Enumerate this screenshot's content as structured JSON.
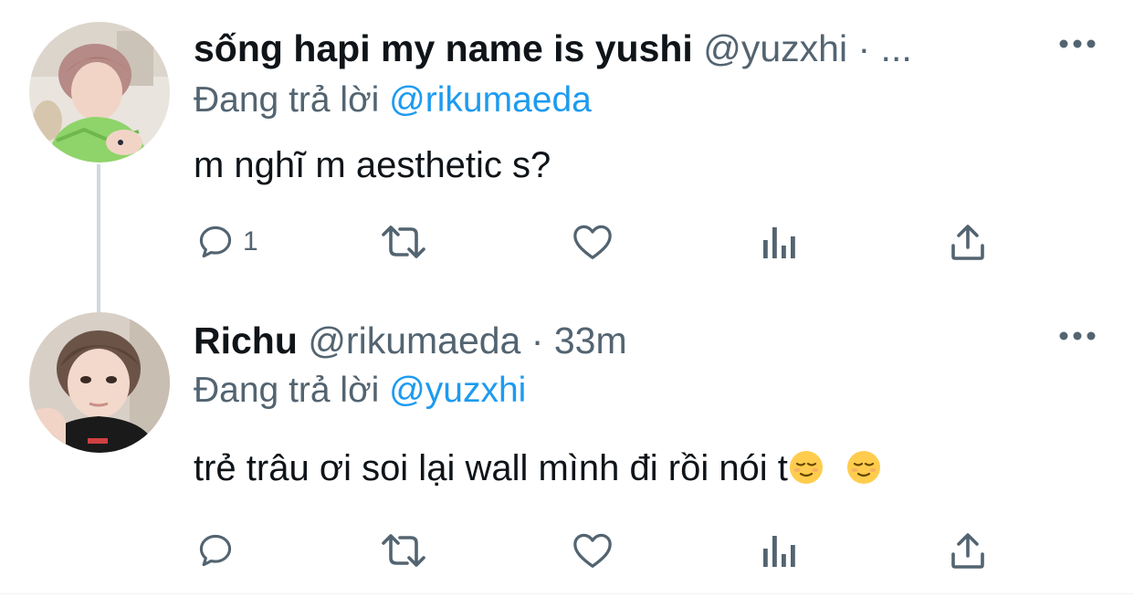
{
  "tweets": [
    {
      "display_name": "sống hapi my name is yushi",
      "handle": "@yuzxhi",
      "separator": "·",
      "time": "...",
      "replying_prefix": "Đang trả lời",
      "replying_to": "@rikumaeda",
      "text": "m nghĩ m aesthetic s?",
      "reply_count": "1",
      "icons": [
        "reply-icon",
        "retweet-icon",
        "like-icon",
        "views-icon",
        "share-icon",
        "more-options-icon"
      ]
    },
    {
      "display_name": "Richu",
      "handle": "@rikumaeda",
      "separator": "·",
      "time": "33m",
      "replying_prefix": "Đang trả lời",
      "replying_to": "@yuzxhi",
      "text": "trẻ trâu ơi soi lại wall mình đi rồi nói t",
      "emojis": [
        "relieved-face-emoji",
        "relieved-face-emoji"
      ],
      "reply_count": "",
      "icons": [
        "reply-icon",
        "retweet-icon",
        "like-icon",
        "views-icon",
        "share-icon",
        "more-options-icon"
      ]
    }
  ],
  "colors": {
    "text": "#0f1419",
    "secondary": "#536471",
    "link": "#1d9bf0",
    "thread_line": "#cfd9de"
  }
}
